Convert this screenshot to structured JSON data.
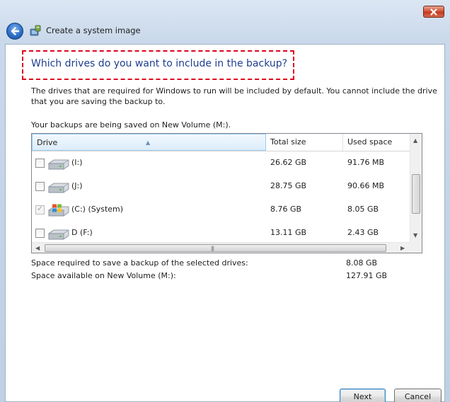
{
  "window": {
    "title": "Create a system image"
  },
  "page": {
    "heading": "Which drives do you want to include in the backup?",
    "description": "The drives that are required for Windows to run will be included by default. You cannot include the drive that you are saving the backup to.",
    "saving_label": "Your backups are being saved on New Volume (M:)."
  },
  "table": {
    "columns": {
      "drive": "Drive",
      "total": "Total size",
      "used": "Used space"
    },
    "rows": [
      {
        "name": "(I:)",
        "total": "26.62 GB",
        "used": "91.76 MB",
        "checked": false,
        "disabled": false,
        "icon": "hard-drive-icon"
      },
      {
        "name": "(J:)",
        "total": "28.75 GB",
        "used": "90.66 MB",
        "checked": false,
        "disabled": false,
        "icon": "hard-drive-icon"
      },
      {
        "name": "(C:) (System)",
        "total": "8.76 GB",
        "used": "8.05 GB",
        "checked": true,
        "disabled": true,
        "icon": "windows-system-drive-icon"
      },
      {
        "name": "D (F:)",
        "total": "13.11 GB",
        "used": "2.43 GB",
        "checked": false,
        "disabled": false,
        "icon": "hard-drive-icon"
      }
    ]
  },
  "summary": {
    "required_label": "Space required to save a backup of the selected drives:",
    "required_value": "8.08 GB",
    "available_label": "Space available on New Volume (M:):",
    "available_value": "127.91 GB"
  },
  "buttons": {
    "next": "Next",
    "cancel": "Cancel"
  },
  "colors": {
    "heading": "#1e3f8e",
    "highlight_border": "#e0001b",
    "close_button": "#c4391f",
    "back_button": "#2e6fc7"
  }
}
